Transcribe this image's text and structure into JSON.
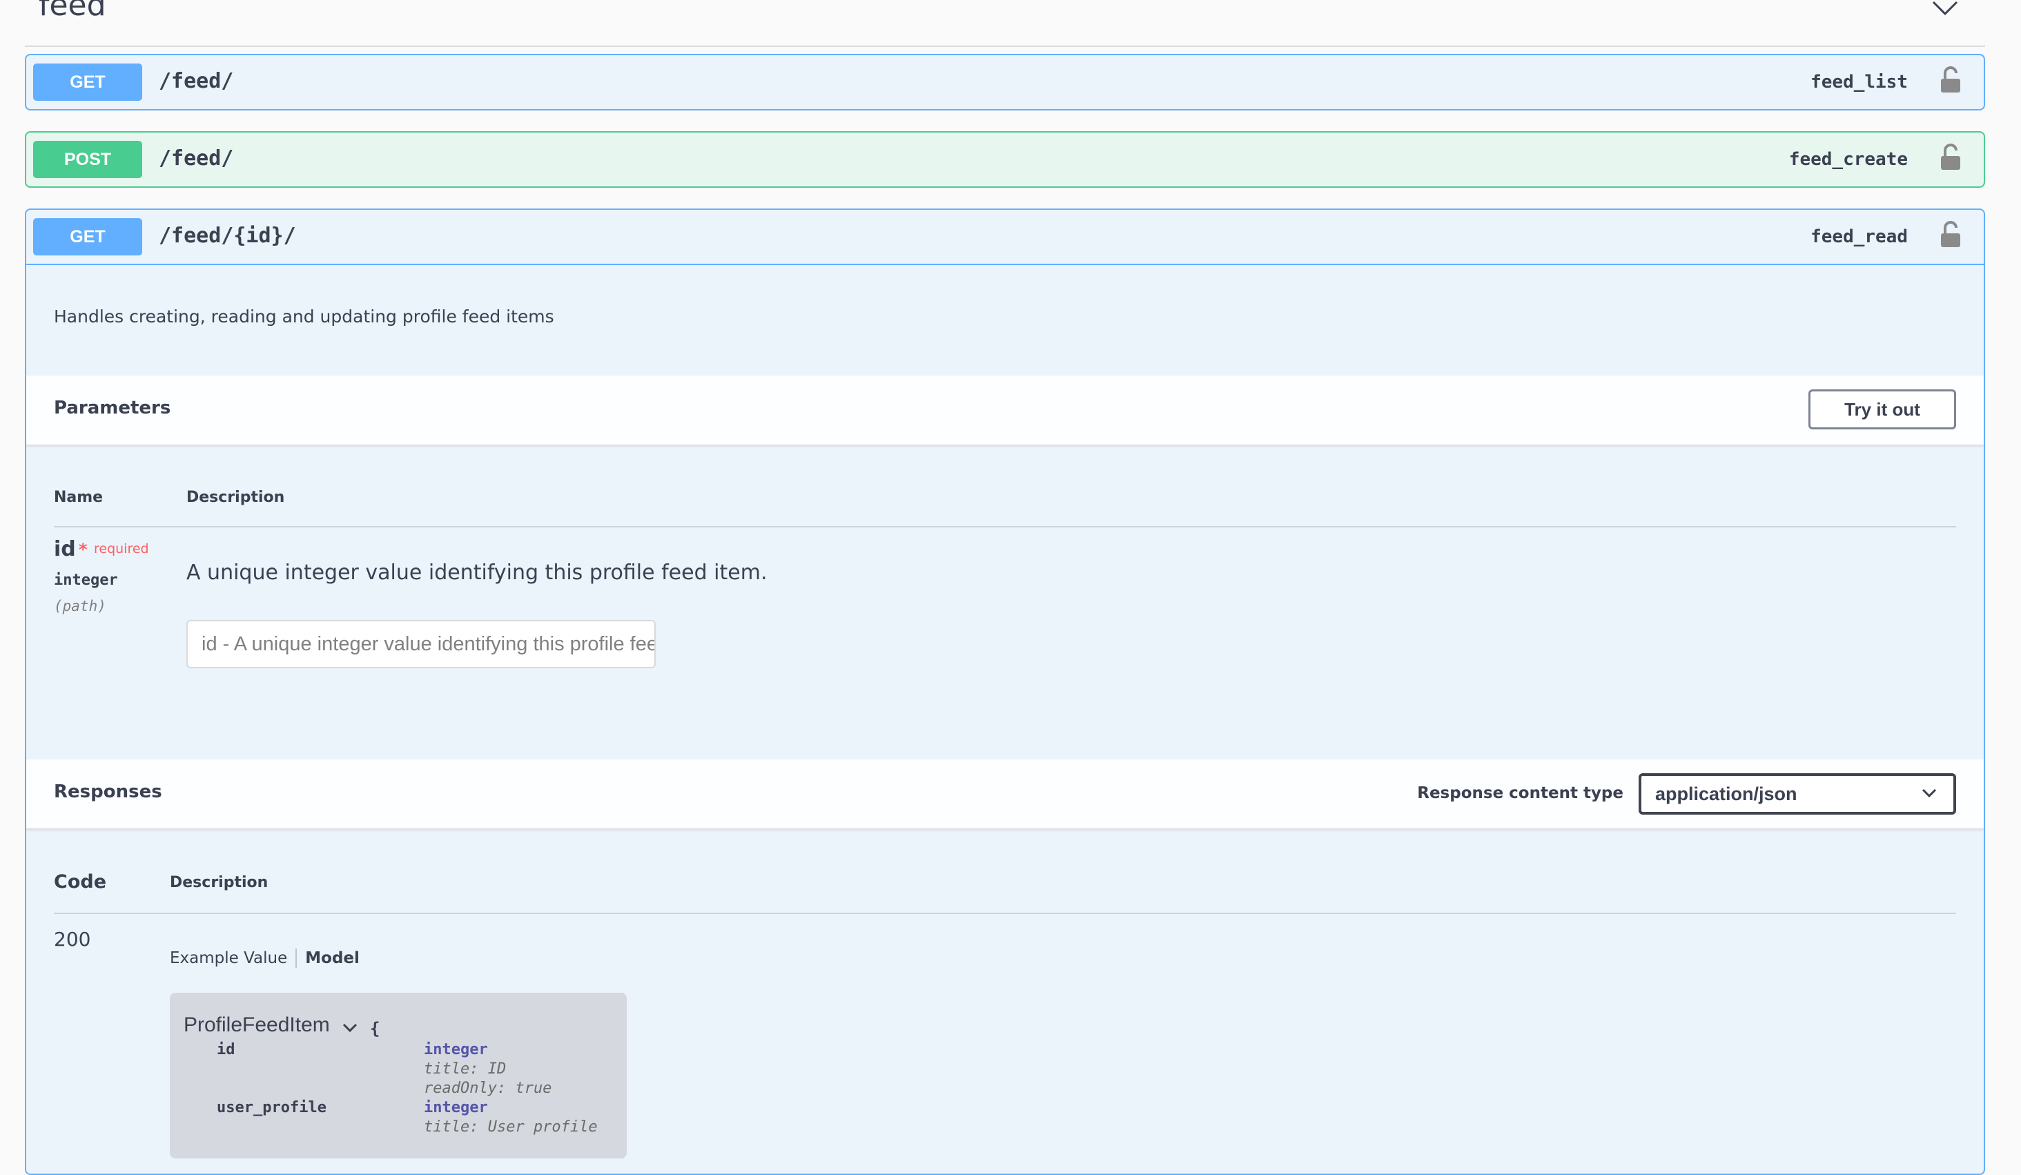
{
  "tag": {
    "title": "feed"
  },
  "operations": [
    {
      "method": "GET",
      "path": "/feed/",
      "operation_id": "feed_list"
    },
    {
      "method": "POST",
      "path": "/feed/",
      "operation_id": "feed_create"
    },
    {
      "method": "GET",
      "path": "/feed/{id}/",
      "operation_id": "feed_read"
    }
  ],
  "expanded": {
    "description": "Handles creating, reading and updating profile feed items",
    "parameters": {
      "title": "Parameters",
      "try_label": "Try it out",
      "col_name": "Name",
      "col_description": "Description",
      "items": [
        {
          "name": "id",
          "required_star": "*",
          "required_label": "required",
          "type": "integer",
          "in": "(path)",
          "description": "A unique integer value identifying this profile feed item.",
          "placeholder": "id - A unique integer value identifying this profile feed item."
        }
      ]
    },
    "responses": {
      "title": "Responses",
      "content_type_label": "Response content type",
      "content_type_value": "application/json",
      "col_code": "Code",
      "col_description": "Description",
      "items": [
        {
          "code": "200",
          "tab_example": "Example Value",
          "tab_model": "Model",
          "model": {
            "name": "ProfileFeedItem",
            "brace": "{",
            "props": [
              {
                "name": "id",
                "type": "integer",
                "meta": [
                  "title: ID",
                  "readOnly: true"
                ]
              },
              {
                "name": "user_profile",
                "type": "integer",
                "meta": [
                  "title: User profile"
                ]
              }
            ]
          }
        }
      ]
    }
  }
}
